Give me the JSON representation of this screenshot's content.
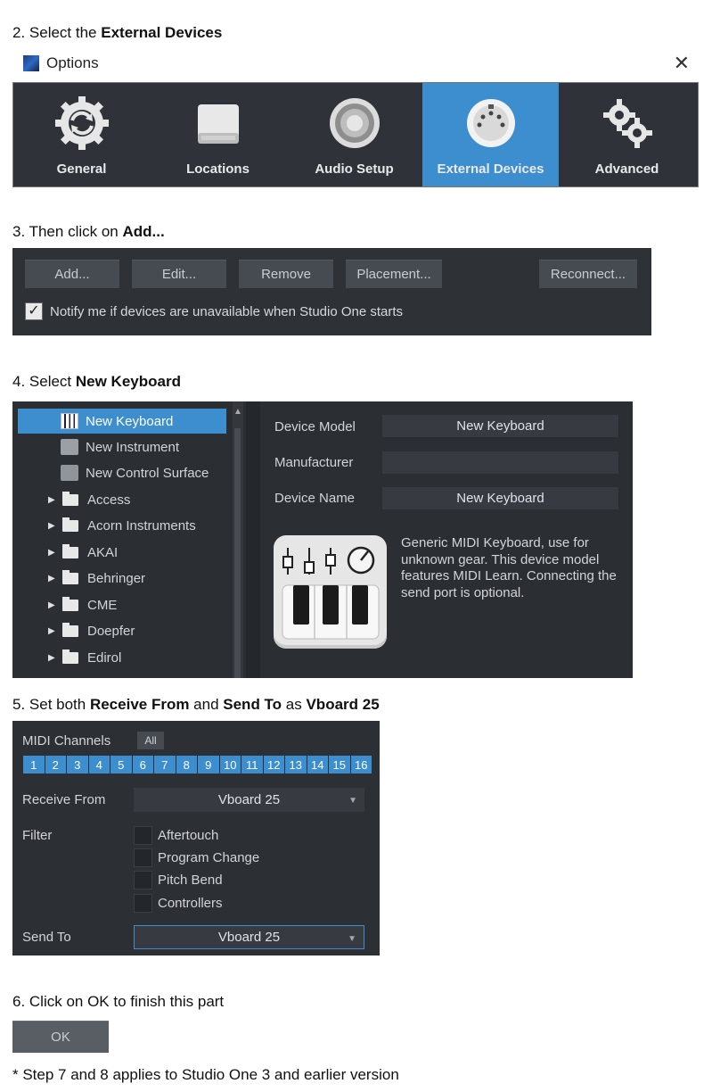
{
  "steps": {
    "s2": {
      "prefix": "2. Select the ",
      "bold": "External Devices"
    },
    "s3": {
      "prefix": "3. Then click on ",
      "bold": "Add..."
    },
    "s4": {
      "prefix": "4. Select ",
      "bold": "New Keyboard"
    },
    "s5": {
      "prefix": "5. Set both ",
      "bold1": "Receive From",
      "mid1": " and ",
      "bold2": "Send To",
      "mid2": " as ",
      "bold3": "Vboard 25"
    },
    "s6": "6. Click on OK to finish this part",
    "note": "* Step 7 and 8 applies to Studio One 3 and earlier version"
  },
  "options_window": {
    "title": "Options",
    "close_glyph": "✕",
    "tabs": [
      {
        "label": "General",
        "icon": "refresh-gear-icon"
      },
      {
        "label": "Locations",
        "icon": "drive-icon"
      },
      {
        "label": "Audio Setup",
        "icon": "speaker-icon"
      },
      {
        "label": "External Devices",
        "icon": "midi-port-icon",
        "active": true
      },
      {
        "label": "Advanced",
        "icon": "gears-icon"
      }
    ]
  },
  "toolbar": {
    "add": "Add...",
    "edit": "Edit...",
    "remove": "Remove",
    "placement": "Placement...",
    "reconnect": "Reconnect...",
    "notify_checked": "✓",
    "notify_label": "Notify me if devices are unavailable when Studio One starts"
  },
  "device_list": {
    "templates": [
      "New Keyboard",
      "New Instrument",
      "New Control Surface"
    ],
    "folders": [
      "Access",
      "Acorn Instruments",
      "AKAI",
      "Behringer",
      "CME",
      "Doepfer",
      "Edirol"
    ],
    "selected": "New Keyboard"
  },
  "device_details": {
    "model_label": "Device Model",
    "model_value": "New Keyboard",
    "manufacturer_label": "Manufacturer",
    "manufacturer_value": "",
    "name_label": "Device Name",
    "name_value": "New Keyboard",
    "description": "Generic MIDI Keyboard, use for unknown gear. This device model features MIDI Learn. Connecting the send port is optional."
  },
  "midi": {
    "channels_label": "MIDI Channels",
    "all_label": "All",
    "channels": [
      "1",
      "2",
      "3",
      "4",
      "5",
      "6",
      "7",
      "8",
      "9",
      "10",
      "11",
      "12",
      "13",
      "14",
      "15",
      "16"
    ],
    "receive_label": "Receive From",
    "receive_value": "Vboard 25",
    "filter_label": "Filter",
    "filters": [
      "Aftertouch",
      "Program Change",
      "Pitch Bend",
      "Controllers"
    ],
    "send_label": "Send To",
    "send_value": "Vboard 25",
    "caret": "▼"
  },
  "ok_label": "OK",
  "colors": {
    "accent": "#3d8ecf",
    "panel": "#2e3237"
  }
}
